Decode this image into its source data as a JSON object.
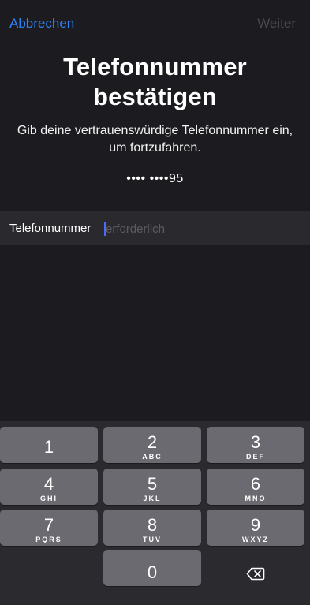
{
  "nav": {
    "cancel_label": "Abbrechen",
    "next_label": "Weiter"
  },
  "header": {
    "title_line1": "Telefonnummer",
    "title_line2": "bestätigen",
    "subtitle_line1": "Gib deine vertrauenswürdige Telefonnummer ein,",
    "subtitle_line2": "um fortzufahren.",
    "masked_number": "•••• ••••95"
  },
  "form": {
    "phone_label": "Telefonnummer",
    "phone_value": "",
    "phone_placeholder": "erforderlich"
  },
  "keypad": {
    "keys": [
      {
        "digit": "1",
        "letters": ""
      },
      {
        "digit": "2",
        "letters": "ABC"
      },
      {
        "digit": "3",
        "letters": "DEF"
      },
      {
        "digit": "4",
        "letters": "GHI"
      },
      {
        "digit": "5",
        "letters": "JKL"
      },
      {
        "digit": "6",
        "letters": "MNO"
      },
      {
        "digit": "7",
        "letters": "PQRS"
      },
      {
        "digit": "8",
        "letters": "TUV"
      },
      {
        "digit": "9",
        "letters": "WXYZ"
      },
      {
        "digit": "0",
        "letters": ""
      }
    ],
    "delete_icon": "delete-backspace-icon"
  },
  "colors": {
    "accent": "#2d82f5",
    "disabled": "#4a4a4e",
    "caret": "#4a6cf7",
    "background": "#1c1b1f",
    "key": "#6b6a70"
  }
}
